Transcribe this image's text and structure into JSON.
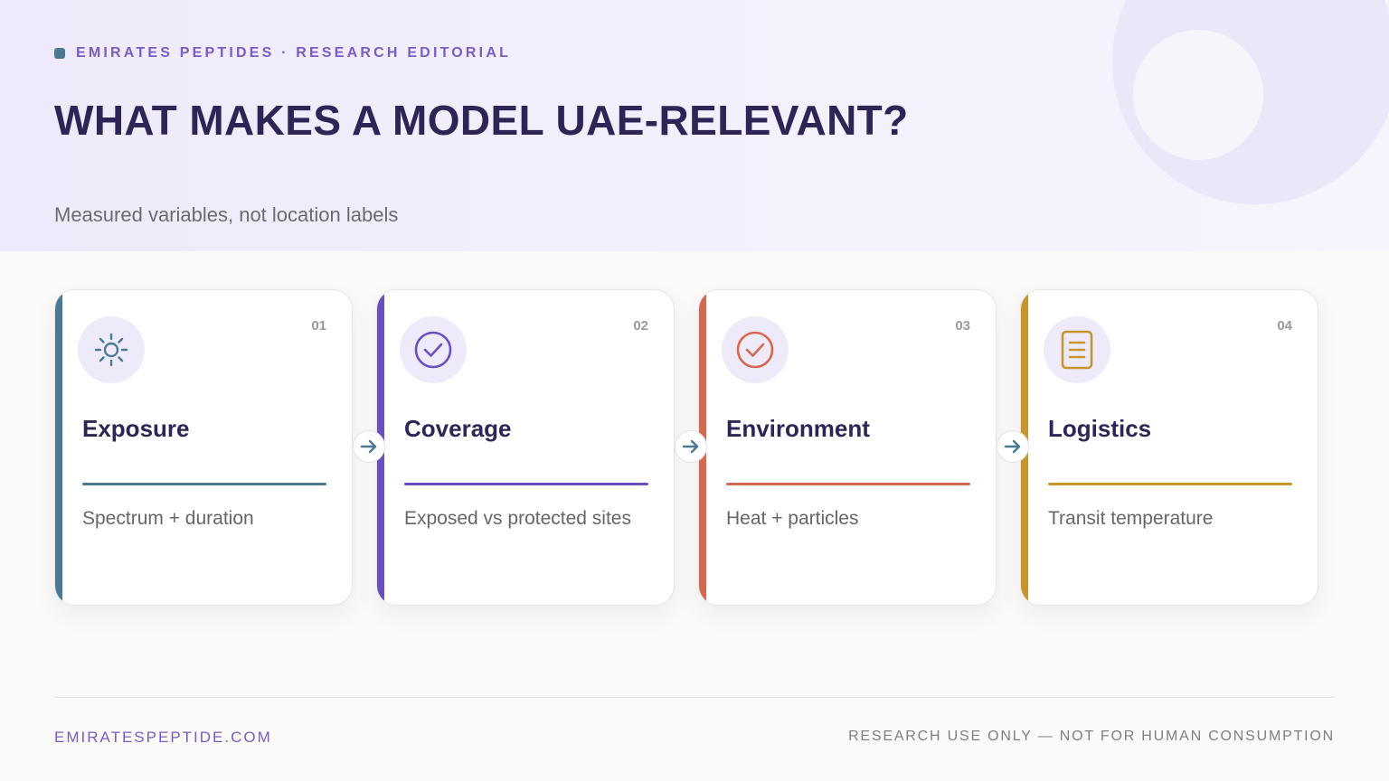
{
  "header": {
    "kicker": "EMIRATES PEPTIDES · RESEARCH EDITORIAL",
    "title": "WHAT MAKES A MODEL UAE-RELEVANT?",
    "subtitle": "Measured variables, not location labels"
  },
  "cards": [
    {
      "number": "01",
      "title": "Exposure",
      "description": "Spectrum + duration",
      "icon": "sun-icon",
      "accent": "#4a7a93"
    },
    {
      "number": "02",
      "title": "Coverage",
      "description": "Exposed vs protected sites",
      "icon": "check-circle-icon",
      "accent": "#6b4fc0"
    },
    {
      "number": "03",
      "title": "Environment",
      "description": "Heat + particles",
      "icon": "check-circle-icon",
      "accent": "#d4694f"
    },
    {
      "number": "04",
      "title": "Logistics",
      "description": "Transit temperature",
      "icon": "document-icon",
      "accent": "#c9952a"
    }
  ],
  "colors": {
    "title": "#2e2556",
    "kicker": "#7b5cc4",
    "arrow": "#4a7a93",
    "icon_bg": "#efeafa"
  },
  "footer": {
    "website": "EMIRATESPEPTIDE.COM",
    "disclaimer": "RESEARCH USE ONLY — NOT FOR HUMAN CONSUMPTION"
  }
}
